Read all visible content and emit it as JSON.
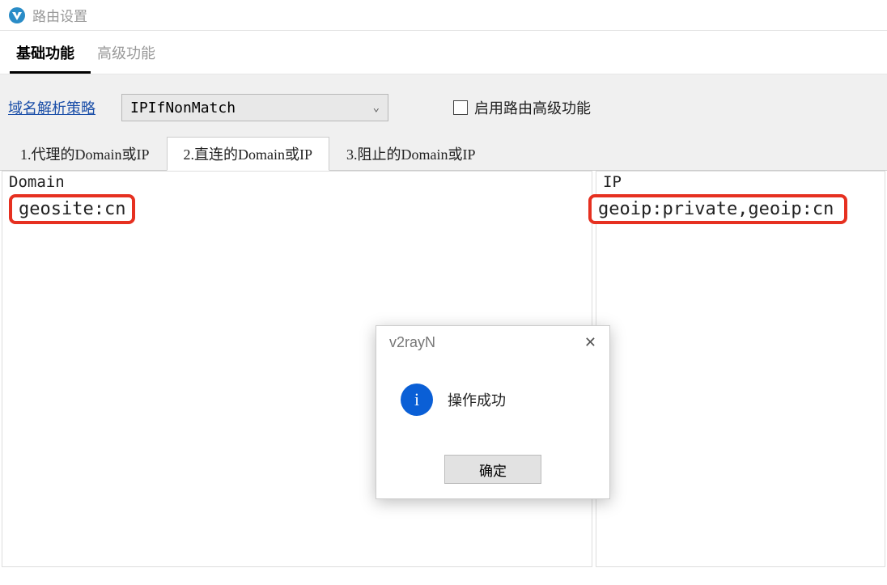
{
  "title": "路由设置",
  "main_tabs": {
    "basic": "基础功能",
    "advanced": "高级功能"
  },
  "toolbar": {
    "dns_strategy_label": "域名解析策略",
    "dns_strategy_value": "IPIfNonMatch",
    "enable_advanced_label": "启用路由高级功能"
  },
  "sub_tabs": {
    "t1": "1.代理的Domain或IP",
    "t2": "2.直连的Domain或IP",
    "t3": "3.阻止的Domain或IP"
  },
  "panels": {
    "domain_label": "Domain",
    "domain_value": "geosite:cn",
    "ip_label": "IP",
    "ip_value": "geoip:private,geoip:cn"
  },
  "dialog": {
    "title": "v2rayN",
    "message": "操作成功",
    "ok_label": "确定"
  }
}
